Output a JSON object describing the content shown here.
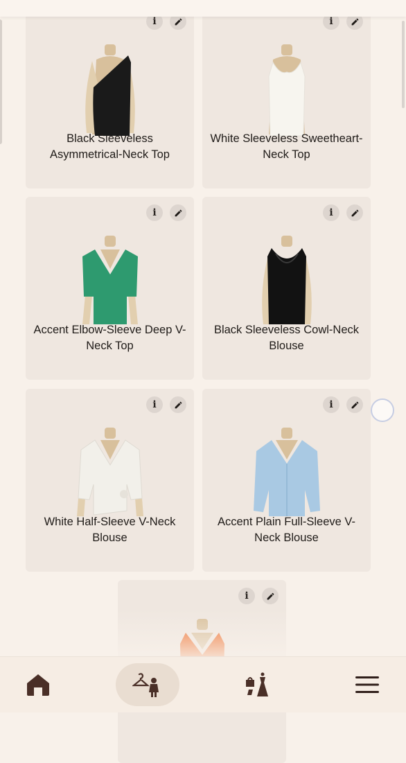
{
  "products": [
    {
      "name": "Black Sleeveless Asymmetrical-Neck Top",
      "color": "#1a1a1a"
    },
    {
      "name": "White Sleeveless Sweetheart-Neck Top",
      "color": "#f7f5ef"
    },
    {
      "name": "Accent Elbow-Sleeve Deep V-Neck Top",
      "color": "#2e9a6f"
    },
    {
      "name": "Black Sleeveless Cowl-Neck Blouse",
      "color": "#121212"
    },
    {
      "name": "White Half-Sleeve V-Neck Blouse",
      "color": "#f2f0ea"
    },
    {
      "name": "Accent Plain Full-Sleeve V-Neck Blouse",
      "color": "#a9c9e3"
    },
    {
      "name": "",
      "color": "#ee6a26"
    }
  ],
  "card_actions": {
    "info_icon": "info-icon",
    "edit_icon": "pencil-icon"
  },
  "nav": {
    "items": [
      {
        "icon": "home-icon",
        "active": false
      },
      {
        "icon": "wardrobe-try-on-icon",
        "active": true
      },
      {
        "icon": "outfits-icon",
        "active": false
      },
      {
        "icon": "menu-icon",
        "active": false
      }
    ]
  },
  "colors": {
    "background": "#f8f1ea",
    "card": "#efe7e0",
    "icon": "#4a2f27",
    "active_pill": "#e9ddd1"
  }
}
